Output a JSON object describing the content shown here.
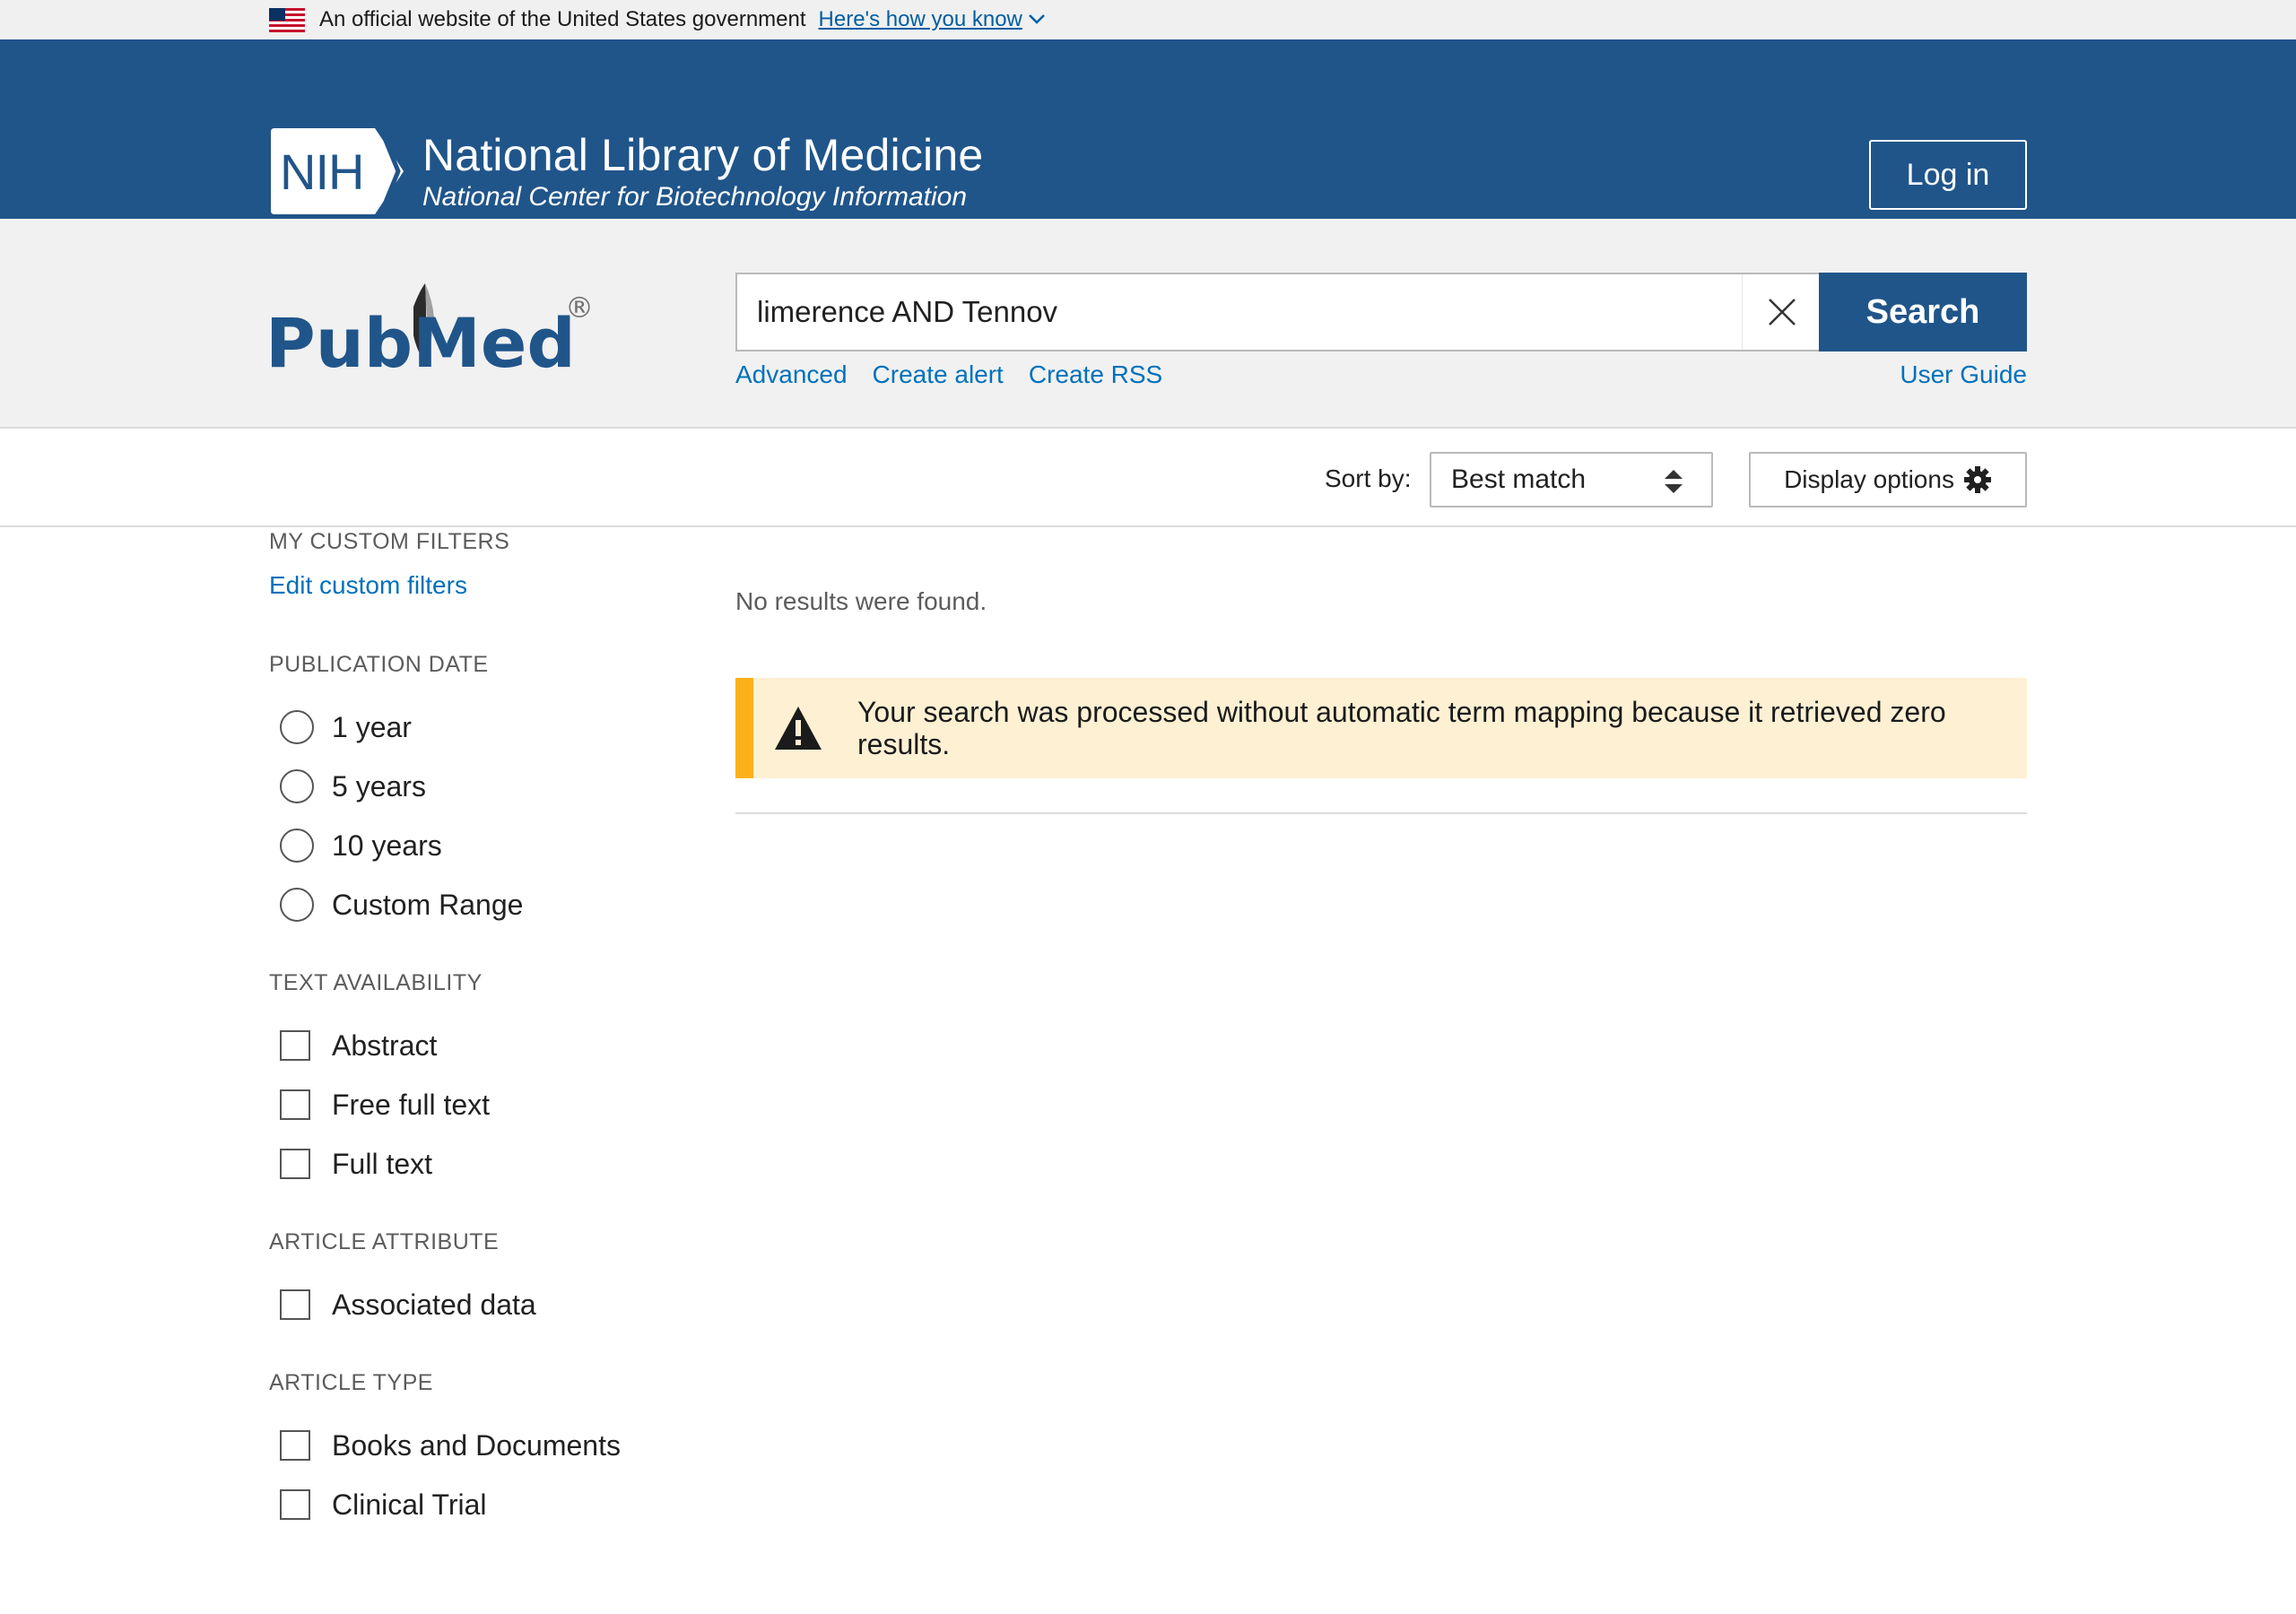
{
  "gov_banner": {
    "text": "An official website of the United States government",
    "link": "Here's how you know"
  },
  "nih": {
    "badge": "NIH",
    "title": "National Library of Medicine",
    "subtitle": "National Center for Biotechnology Information",
    "login_label": "Log in"
  },
  "search": {
    "logo_text": "PubMed",
    "logo_mark": "®",
    "query": "limerence AND Tennov",
    "button_label": "Search",
    "links": [
      "Advanced",
      "Create alert",
      "Create RSS"
    ],
    "user_guide": "User Guide"
  },
  "sort": {
    "label": "Sort by:",
    "value": "Best match",
    "display_options": "Display options"
  },
  "sidebar": {
    "custom_filters_heading": "MY CUSTOM FILTERS",
    "edit_custom_filters": "Edit custom filters",
    "publication_date_heading": "PUBLICATION DATE",
    "publication_date_options": [
      "1 year",
      "5 years",
      "10 years",
      "Custom Range"
    ],
    "text_availability_heading": "TEXT AVAILABILITY",
    "text_availability_options": [
      "Abstract",
      "Free full text",
      "Full text"
    ],
    "article_attribute_heading": "ARTICLE ATTRIBUTE",
    "article_attribute_options": [
      "Associated data"
    ],
    "article_type_heading": "ARTICLE TYPE",
    "article_type_options": [
      "Books and Documents",
      "Clinical Trial"
    ]
  },
  "results": {
    "no_results": "No results were found.",
    "warning": "Your search was processed without automatic term mapping because it retrieved zero results."
  },
  "colors": {
    "header_blue": "#20558a",
    "link_blue": "#0071bc",
    "warning_bg": "#fef0d3",
    "warning_bar": "#fbb11a"
  }
}
